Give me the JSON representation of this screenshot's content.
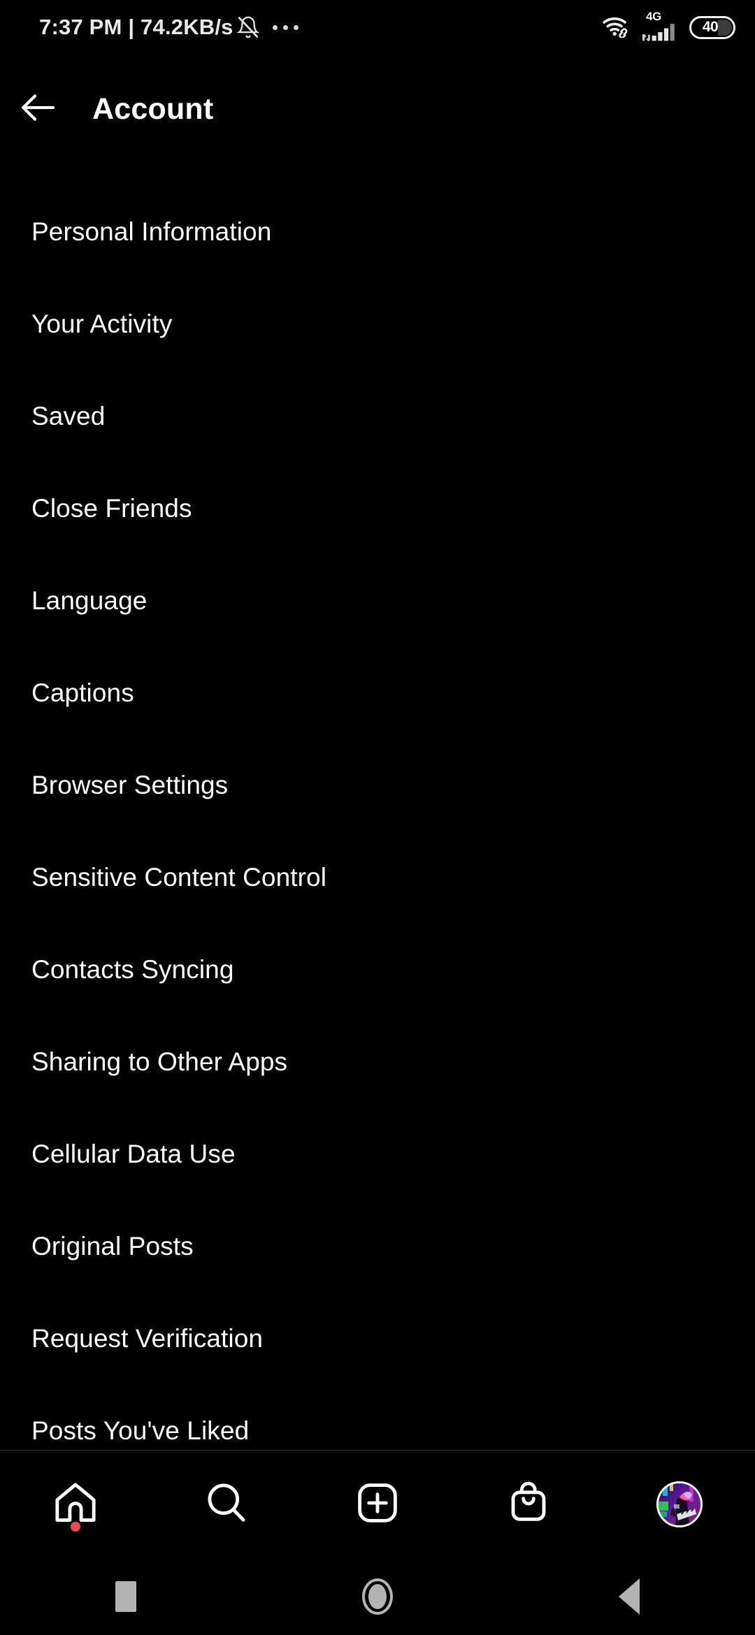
{
  "status_bar": {
    "clock_and_speed": "7:37 PM | 74.2KB/s",
    "bell_icon": "bell-muted-icon",
    "overflow_icon": "more-dots-icon",
    "wifi_icon": "wifi-link-icon",
    "network_label": "4G",
    "signal_icon": "signal-bars-icon",
    "battery_level": "40"
  },
  "header": {
    "back_icon": "arrow-left-icon",
    "title": "Account"
  },
  "menu": {
    "items": [
      {
        "label": "Personal Information"
      },
      {
        "label": "Your Activity"
      },
      {
        "label": "Saved"
      },
      {
        "label": "Close Friends"
      },
      {
        "label": "Language"
      },
      {
        "label": "Captions"
      },
      {
        "label": "Browser Settings"
      },
      {
        "label": "Sensitive Content Control"
      },
      {
        "label": "Contacts Syncing"
      },
      {
        "label": "Sharing to Other Apps"
      },
      {
        "label": "Cellular Data Use"
      },
      {
        "label": "Original Posts"
      },
      {
        "label": "Request Verification"
      },
      {
        "label": "Posts You've Liked"
      }
    ]
  },
  "bottom_nav": {
    "items": [
      {
        "name": "home",
        "icon": "home-icon",
        "has_badge": true
      },
      {
        "name": "search",
        "icon": "search-icon",
        "has_badge": false
      },
      {
        "name": "create",
        "icon": "plus-square-icon",
        "has_badge": false
      },
      {
        "name": "shop",
        "icon": "shopping-bag-icon",
        "has_badge": false
      },
      {
        "name": "profile",
        "icon": "avatar-icon",
        "has_badge": false
      }
    ],
    "badge_color": "#ed4956"
  },
  "android_nav": {
    "recents_icon": "square-icon",
    "home_icon": "circle-icon",
    "back_icon": "triangle-back-icon",
    "color": "#b3b3b3"
  },
  "theme": {
    "background": "#000000",
    "text": "#ffffff",
    "divider": "#2e2e2e"
  }
}
